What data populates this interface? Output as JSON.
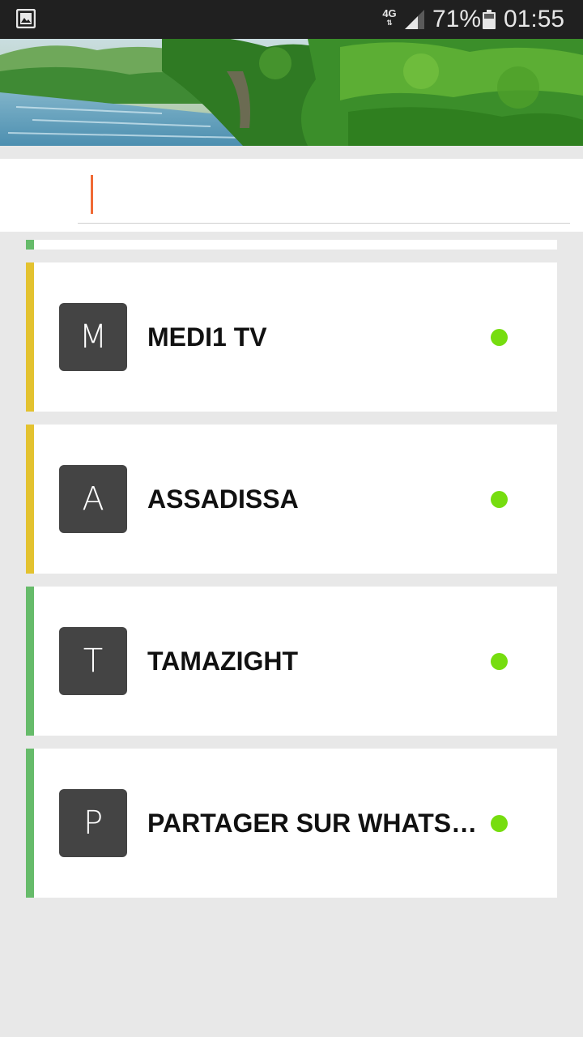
{
  "status_bar": {
    "network": "4G",
    "battery_percent": "71%",
    "time": "01:55"
  },
  "search": {
    "placeholder": "",
    "value": ""
  },
  "colors": {
    "caret": "#f06a35",
    "status_online": "#76dd0f",
    "stripe_yellow": "#e3c22f",
    "stripe_green": "#66bb6a"
  },
  "channels": [
    {
      "letter": "M",
      "name": "MEDI1 TV",
      "stripe": "yellow",
      "status": "online"
    },
    {
      "letter": "A",
      "name": "ASSADISSA",
      "stripe": "yellow",
      "status": "online"
    },
    {
      "letter": "T",
      "name": "TAMAZIGHT",
      "stripe": "green",
      "status": "online"
    },
    {
      "letter": "P",
      "name": "PARTAGER SUR WHATSAPP",
      "stripe": "green",
      "status": "online"
    }
  ]
}
